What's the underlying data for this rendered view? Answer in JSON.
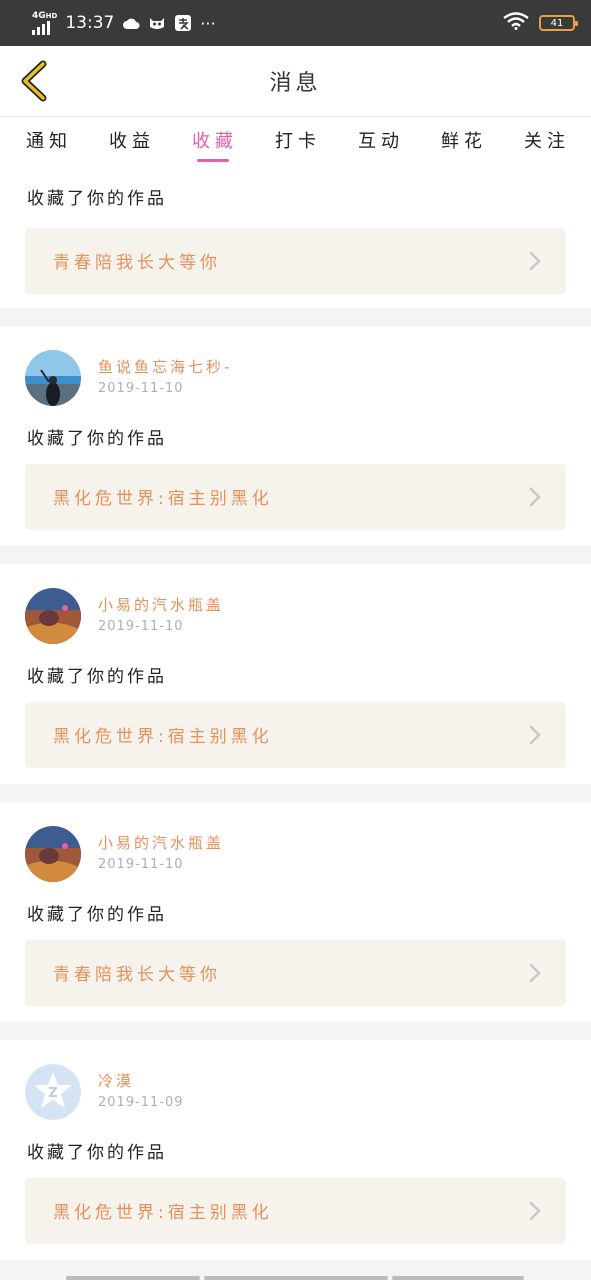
{
  "status_bar": {
    "network": "4G",
    "network_sub": "HD",
    "time": "13:37",
    "more": "···",
    "battery": "41"
  },
  "header": {
    "title": "消息"
  },
  "tabs": [
    {
      "label": "通知"
    },
    {
      "label": "收益"
    },
    {
      "label": "收藏"
    },
    {
      "label": "打卡"
    },
    {
      "label": "互动"
    },
    {
      "label": "鲜花"
    },
    {
      "label": "关注"
    }
  ],
  "active_tab": "收藏",
  "messages": [
    {
      "action": "收藏了你的作品",
      "work": "青春陪我长大等你"
    },
    {
      "user": "鱼说鱼忘海七秒-",
      "date": "2019-11-10",
      "action": "收藏了你的作品",
      "work": "黑化危世界:宿主别黑化"
    },
    {
      "user": "小易的汽水瓶盖",
      "date": "2019-11-10",
      "action": "收藏了你的作品",
      "work": "黑化危世界:宿主别黑化"
    },
    {
      "user": "小易的汽水瓶盖",
      "date": "2019-11-10",
      "action": "收藏了你的作品",
      "work": "青春陪我长大等你"
    },
    {
      "user": "冷漠",
      "date": "2019-11-09",
      "action": "收藏了你的作品",
      "work": "黑化危世界:宿主别黑化"
    }
  ],
  "colors": {
    "accent": "#e85fa8",
    "name": "#e8905a",
    "back_icon": "#e8c020"
  }
}
